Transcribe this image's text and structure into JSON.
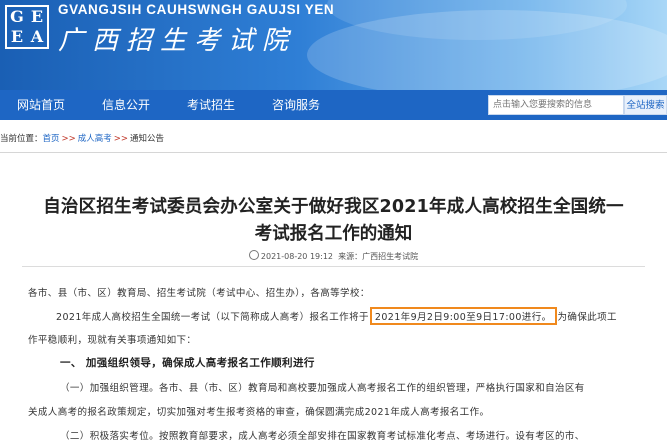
{
  "header": {
    "logo_letters": [
      "G",
      "E",
      "E",
      "A"
    ],
    "site_name_en": "GVANGJSIH CAUHSWNGH GAUJSI YEN",
    "site_name_cn": "广西招生考试院"
  },
  "nav": {
    "items": [
      {
        "label": "网站首页"
      },
      {
        "label": "信息公开"
      },
      {
        "label": "考试招生"
      },
      {
        "label": "咨询服务"
      }
    ],
    "search_placeholder": "点击输入您要搜索的信息",
    "search_button": "全站搜索"
  },
  "breadcrumb": {
    "prefix": "当前位置：",
    "items": [
      "首页",
      "成人高考",
      "通知公告"
    ],
    "sep": ">>"
  },
  "article": {
    "title_line1": "自治区招生考试委员会办公室关于做好我区2021年成人高校招生全国统一",
    "title_line2": "考试报名工作的通知",
    "date": "2021-08-20 19:12",
    "source": "来源：广西招生考试院",
    "salutation": "各市、县（市、区）教育局、招生考试院（考试中心、招生办），各高等学校：",
    "para1_a": "2021年成人高校招生全国统一考试（以下简称成人高考）报名工作将于",
    "para1_highlight": "2021年9月2日9:00至9日17:00进行。",
    "para1_b": "为确保此项工",
    "para1_c": "作平稳顺利，现就有关事项通知如下：",
    "section1": "一、 加强组织领导，确保成人高考报名工作顺利进行",
    "para2_a": "（一）加强组织管理。各市、县（市、区）教育局和高校要加强成人高考报名工作的组织管理，严格执行国家和自治区有",
    "para2_b": "关成人高考的报名政策规定，切实加强对考生报考资格的审查，确保圆满完成2021年成人高考报名工作。",
    "para3_a": "（二）积极落实考位。按照教育部要求，成人高考必须全部安排在国家教育考试标准化考点、考场进行。设有考区的市、"
  }
}
